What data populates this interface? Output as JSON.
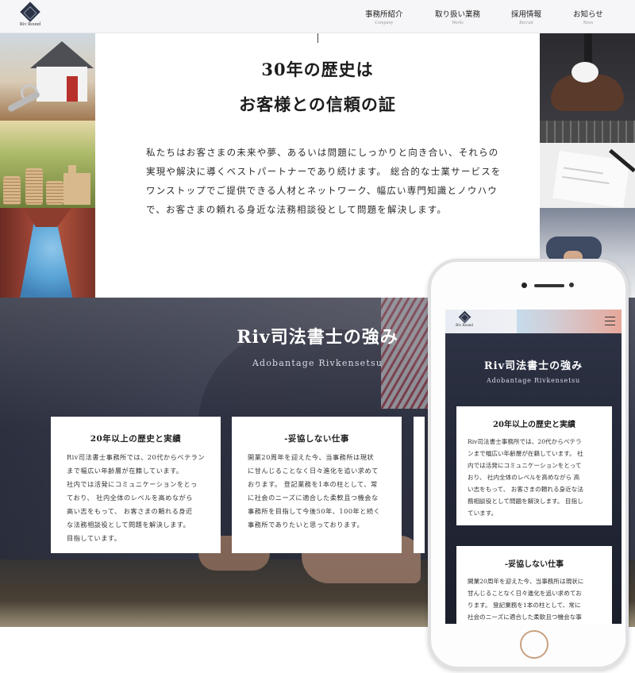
{
  "header": {
    "logo_text": "Riv Round",
    "nav": [
      {
        "jp": "",
        "en": ""
      },
      {
        "jp": "事務所紹介",
        "en": "Company"
      },
      {
        "jp": "取り扱い業務",
        "en": "Works"
      },
      {
        "jp": "採用情報",
        "en": "Recruit"
      },
      {
        "jp": "お知らせ",
        "en": "News"
      }
    ]
  },
  "intro": {
    "title_line1": "30年の歴史は",
    "title_line2": "お客様との信頼の証",
    "body_lines": [
      "私たちはお客さまの未来や夢、あるいは問題にしっかりと向き合い、それらの",
      "実現や解決に導くベストパートナーであり続けます。 総合的な士業サービスを",
      "ワンストップでご提供できる人材とネットワーク、幅広い専門知識とノウハウ",
      "で、お客さまの頼れる身近な法務相談役として問題を解決します。"
    ]
  },
  "strengths": {
    "title": "Riv司法書士の強み",
    "subtitle": "Adobantage Rivkensetsu",
    "cards": [
      {
        "title": "20年以上の歴史と実績",
        "lines": [
          "Riv司法書士事務所では、20代からベテラン",
          "まで幅広い年齢層が在籍しています。",
          "社内では活発にコミュニケーションをとっ",
          "ており、 社内全体のレベルを高めながら",
          "高い志をもって、 お客さまの頼れる身近",
          "な法務相談役として問題を解決します。",
          "目指しています。"
        ]
      },
      {
        "title": "-妥協しない仕事",
        "lines": [
          "開業20周年を迎えた今、当事務所は現状",
          "に甘んじることなく日々進化を追い求めて",
          "おります。 登記業務を1本の柱として、常",
          "に社会のニーズに適合した柔軟且つ機会な",
          "事務所を目指して今後50年、100年と続く",
          "事務所でありたいと思っております。"
        ]
      }
    ]
  },
  "mobile": {
    "logo_text": "Riv Round",
    "title": "Riv司法書士の強み",
    "subtitle": "Adobantage Rivkensetsu",
    "cards": [
      {
        "title": "20年以上の歴史と実績",
        "lines": [
          "Riv司法書士事務所では、20代からベテラ",
          "ンまで幅広い年齢層が在籍しています。 社",
          "内では活発にコミュニケーションをとって",
          "おり、 社内全体のレベルを高めながら 高",
          "い志をもって、 お客さまの頼れる身近な法",
          "務相談役として問題を解決します。 目指し",
          "ています。"
        ]
      },
      {
        "title": "-妥協しない仕事",
        "lines": [
          "開業20周年を迎えた今、当事務所は現状に",
          "甘んじることなく日々進化を追い求めてお",
          "ります。 登記業務を1本の柱として、常に",
          "社会のニーズに適合した柔軟且つ機会な事"
        ]
      }
    ]
  },
  "colors": {
    "header_bg": "#f6f6f8",
    "section_bg": "#2f3446",
    "card_bg": "#ffffff",
    "home_button_ring": "#c9a07f"
  },
  "icons": [
    "logo-diamond-icon",
    "hamburger-menu-icon"
  ]
}
